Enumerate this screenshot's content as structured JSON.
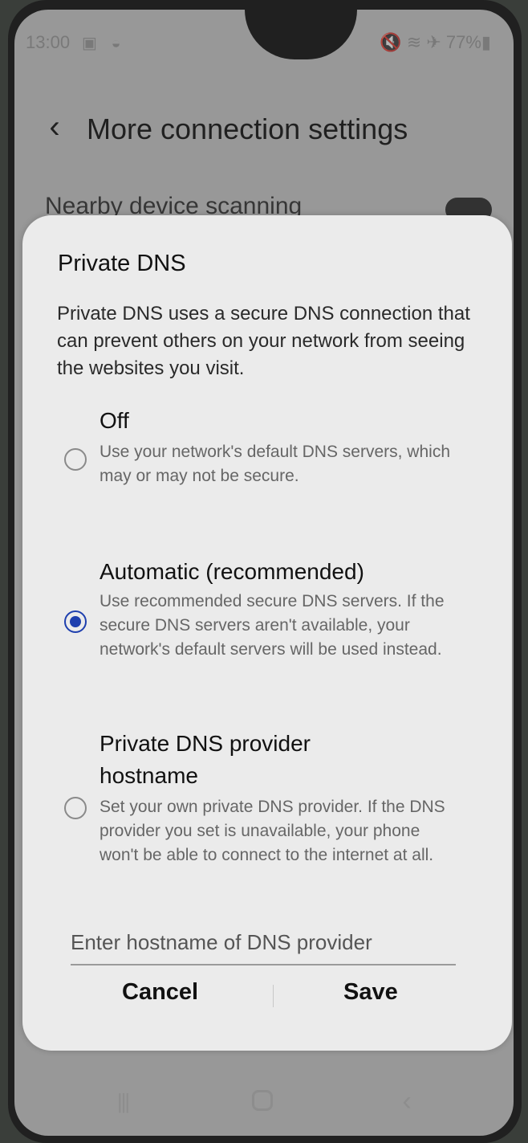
{
  "status_bar": {
    "time": "13:00",
    "left_icons": "▣ ◒",
    "right_status": "🔇 ≋ ✈ 77%▮"
  },
  "app_bar": {
    "back_icon": "‹",
    "title": "More connection settings"
  },
  "background": {
    "row_label": "Nearby device scanning"
  },
  "dialog": {
    "title": "Private DNS",
    "description": "Private DNS uses a secure DNS connection that can prevent others on your network from seeing the websites you visit.",
    "options": [
      {
        "title": "Off",
        "description": "Use your network's default DNS servers, which may or may not be secure.",
        "selected": false
      },
      {
        "title": "Automatic (recommended)",
        "description": "Use recommended secure DNS servers. If the secure DNS servers aren't available, your network's default servers will be used instead.",
        "selected": true
      },
      {
        "title": "Private DNS provider hostname",
        "description": "Set your own private DNS provider. If the DNS provider you set is unavailable, your phone won't be able to connect to the internet at all.",
        "selected": false
      }
    ],
    "hostname_input": {
      "placeholder": "Enter hostname of DNS provider",
      "value": ""
    },
    "cancel_label": "Cancel",
    "save_label": "Save"
  },
  "nav_bar": {
    "recents_icon": "|||",
    "back_icon": "‹"
  },
  "colors": {
    "accent": "#1e3fae",
    "dialog_bg": "#ebebeb"
  }
}
